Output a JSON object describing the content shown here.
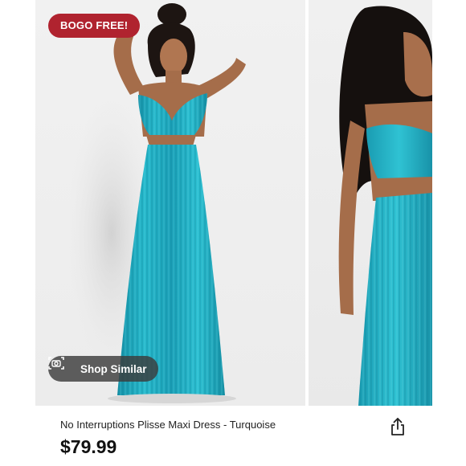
{
  "badge": {
    "label": "BOGO FREE!"
  },
  "shop_similar": {
    "label": "Shop Similar",
    "icon": "camera-search-icon"
  },
  "product": {
    "title": "No Interruptions Plisse Maxi Dress - Turquoise",
    "price": "$79.99"
  },
  "share": {
    "icon": "share-icon"
  },
  "colors": {
    "badge_bg": "#b0232f",
    "dress": "#1fa7bd",
    "background": "#eeeeee"
  }
}
